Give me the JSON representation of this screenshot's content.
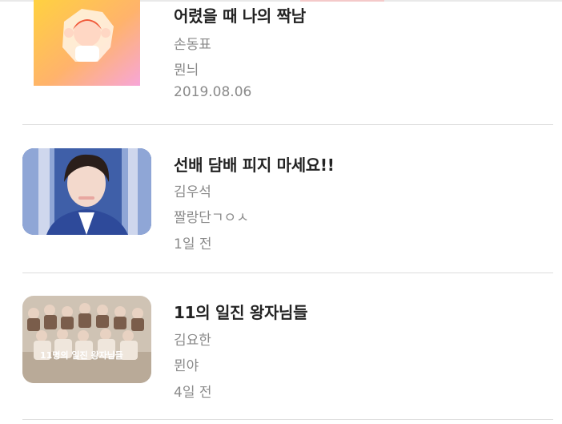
{
  "stories": [
    {
      "title": "어렸을 때 나의 짝남",
      "author": "손동표",
      "fandom": "뭔늬",
      "date": "2019.08.06",
      "thumbnail_icon": "boy-through-paper-illustration"
    },
    {
      "title": "선배 담배 피지 마세요!!",
      "author": "김우석",
      "fandom": "짤랑단ㄱㅇㅅ",
      "date": "1일 전",
      "thumbnail_icon": "student-portrait-photo"
    },
    {
      "title": "11의 일진 왕자님들",
      "author": "김요한",
      "fandom": "뮌야",
      "date": "4일 전",
      "thumbnail_icon": "group-photo",
      "thumbnail_caption": "11명의 일진 왕자님들"
    }
  ],
  "colors": {
    "title": "#232323",
    "meta": "#8a8a8a",
    "divider": "#dcdcdc"
  }
}
